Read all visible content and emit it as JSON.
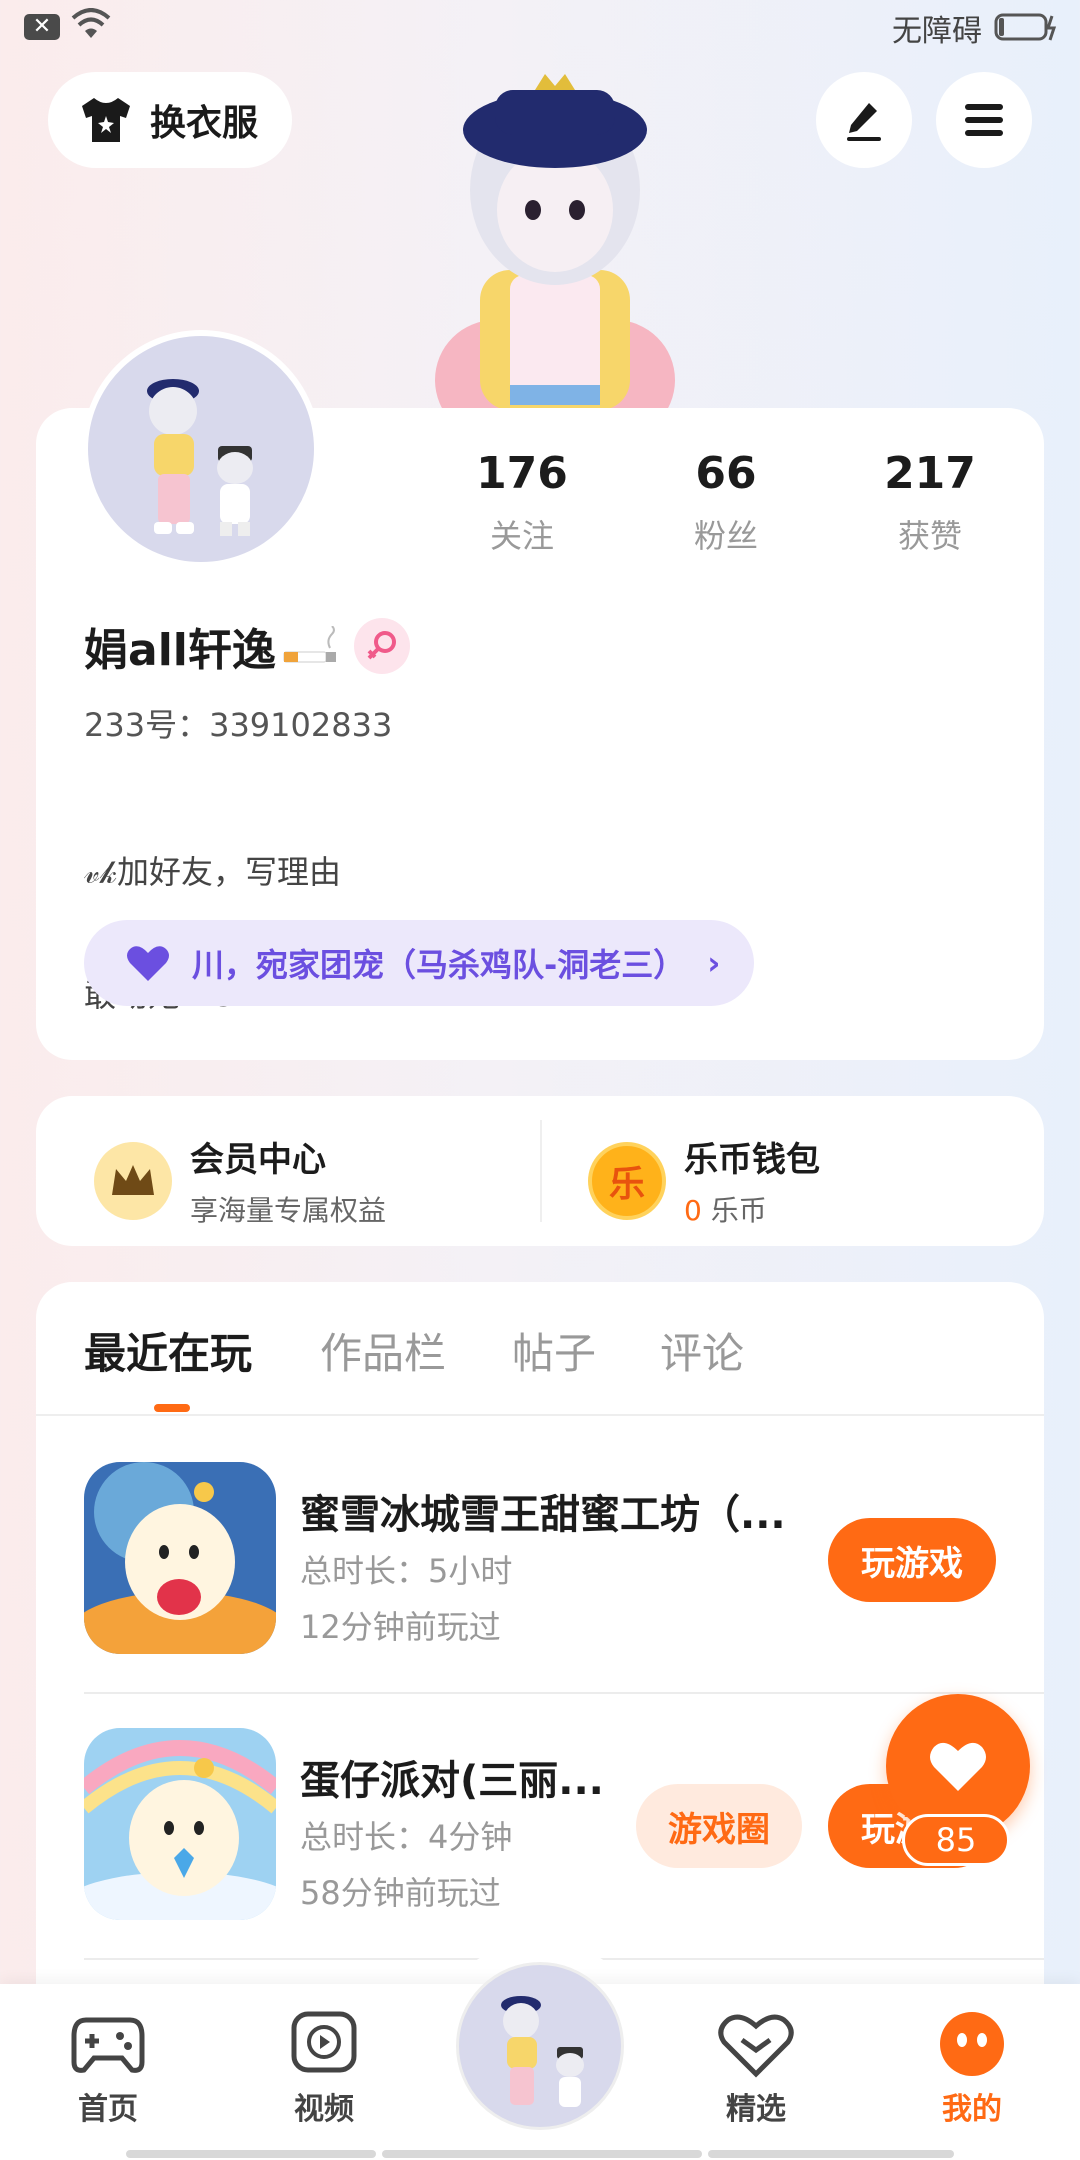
{
  "status_bar": {
    "close_glyph": "✕",
    "accessibility": "无障碍"
  },
  "top": {
    "outfit_label": "换衣服"
  },
  "stats": [
    {
      "num": "176",
      "label": "关注"
    },
    {
      "num": "66",
      "label": "粉丝"
    },
    {
      "num": "217",
      "label": "获赞"
    }
  ],
  "profile": {
    "nickname": "娟all轩逸",
    "uid": "233号：339102833",
    "bio_line1": "𝓋𝓀加好友，写理由",
    "bio_line2": "敢动她≡Ｓ",
    "bio_line3": "↓",
    "family": "川，宛家团宠（马杀鸡队-洞老三）",
    "chevron": "›"
  },
  "membership": {
    "title": "会员中心",
    "subtitle": "享海量专属权益"
  },
  "wallet": {
    "title": "乐币钱包",
    "coin_glyph": "乐",
    "balance": "0",
    "unit": "乐币"
  },
  "tabs": [
    "最近在玩",
    "作品栏",
    "帖子",
    "评论"
  ],
  "games": [
    {
      "name": "蜜雪冰城雪王甜蜜工坊（...",
      "duration": "总时长：5小时",
      "last": "12分钟前玩过",
      "play": "玩游戏"
    },
    {
      "name": "蛋仔派对(三丽...",
      "duration": "总时长：4分钟",
      "last": "58分钟前玩过",
      "circle": "游戏圈",
      "play": "玩游戏"
    }
  ],
  "like": {
    "count": "85"
  },
  "nav": {
    "home": "首页",
    "video": "视频",
    "featured": "精选",
    "mine": "我的"
  },
  "colors": {
    "accent": "#ff6a14",
    "purple": "#6b4fe0"
  }
}
